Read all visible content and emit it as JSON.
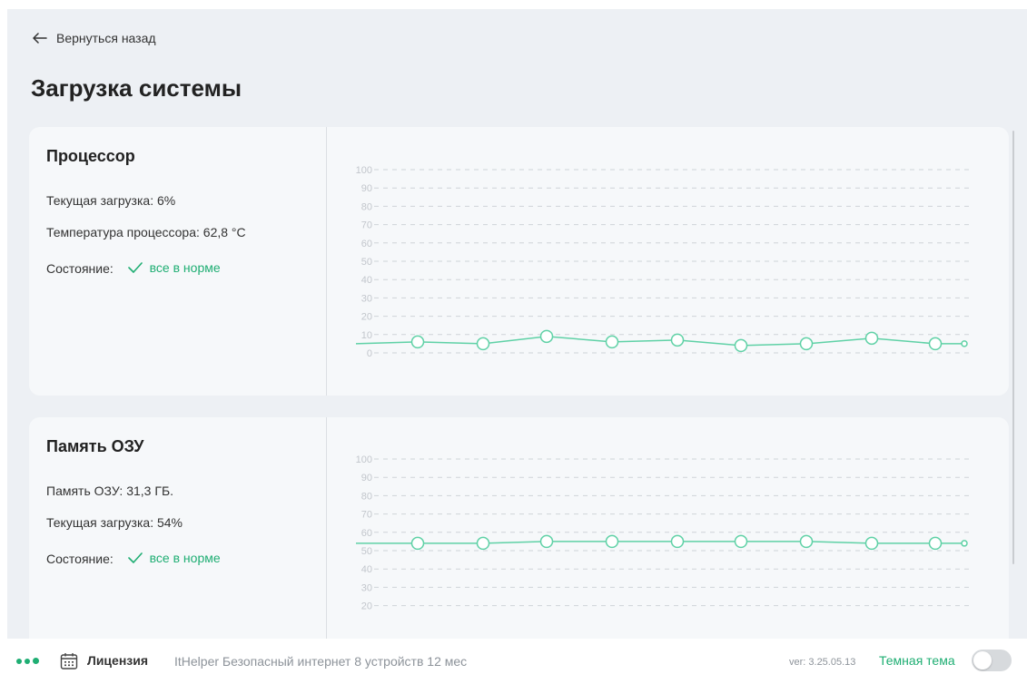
{
  "back": {
    "label": "Вернуться назад"
  },
  "page_title": "Загрузка системы",
  "cpu": {
    "title": "Процессор",
    "load_label": "Текущая загрузка:",
    "load_value": "6%",
    "temp_label": "Температура процессора:",
    "temp_value": "62,8 °C",
    "status_label": "Состояние:",
    "status_value": "все в норме"
  },
  "ram": {
    "title": "Память ОЗУ",
    "mem_label": "Память ОЗУ:",
    "mem_value": "31,3 ГБ.",
    "load_label": "Текущая загрузка:",
    "load_value": "54%",
    "status_label": "Состояние:",
    "status_value": "все в норме"
  },
  "footer": {
    "license_label": "Лицензия",
    "license_text": "ItHelper Безопасный интернет 8 устройств 12 мес",
    "version": "ver: 3.25.05.13",
    "theme_label": "Темная тема",
    "dark_theme_enabled": false
  },
  "colors": {
    "accent": "#1fae73",
    "line": "#5fd1a6",
    "grid": "#cfd3d8"
  },
  "icons": {
    "back": "arrow-left-icon",
    "status": "check-icon",
    "license": "calendar-icon"
  },
  "chart_data": [
    {
      "type": "line",
      "yticks": [
        "100",
        "90",
        "80",
        "70",
        "60",
        "50",
        "40",
        "30",
        "20",
        "10",
        "0"
      ],
      "ylim": [
        0,
        100
      ],
      "values": [
        5,
        6,
        5,
        9,
        6,
        7,
        4,
        5,
        8,
        5,
        5
      ]
    },
    {
      "type": "line",
      "yticks": [
        "100",
        "90",
        "80",
        "70",
        "60",
        "50",
        "40",
        "30",
        "20"
      ],
      "ylim": [
        0,
        100
      ],
      "values": [
        54,
        54,
        54,
        55,
        55,
        55,
        55,
        55,
        54,
        54,
        54
      ]
    }
  ]
}
